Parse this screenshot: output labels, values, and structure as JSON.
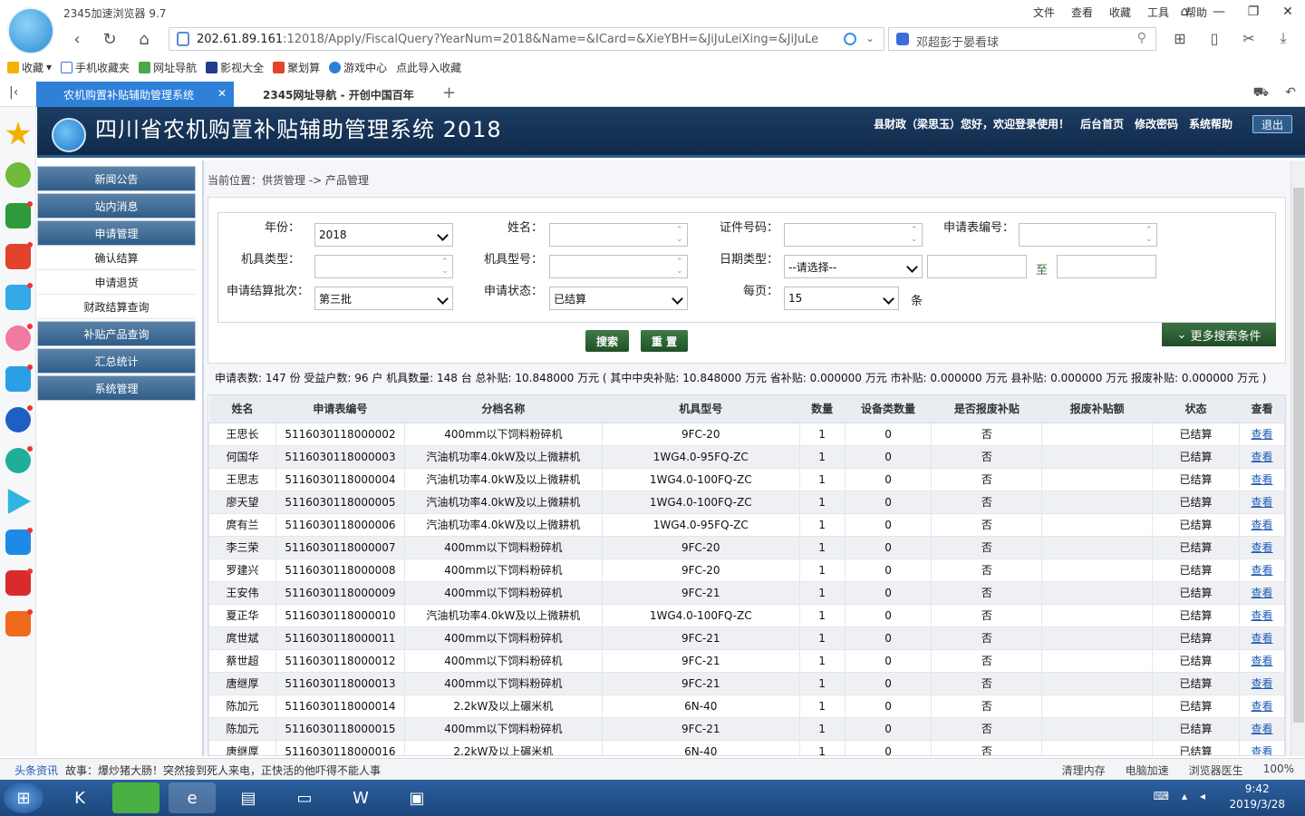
{
  "browser": {
    "app_title": "2345加速浏览器 9.7",
    "menu": [
      "文件",
      "查看",
      "收藏",
      "工具",
      "帮助"
    ],
    "url_host": "202.61.89.161",
    "url_rest": ":12018/Apply/FiscalQuery?YearNum=2018&Name=&ICard=&XieYBH=&JiJuLeiXing=&JiJuLe",
    "search_text": "邓超彭于晏看球",
    "bookmarks": [
      "收藏",
      "手机收藏夹",
      "网址导航",
      "影视大全",
      "聚划算",
      "游戏中心",
      "点此导入收藏"
    ],
    "tabs": [
      {
        "label": "农机购置补贴辅助管理系统",
        "active": true
      },
      {
        "label": "2345网址导航 - 开创中国百年",
        "active": false
      }
    ]
  },
  "header": {
    "system_title": "四川省农机购置补贴辅助管理系统 2018",
    "user_greeting": "县财政（梁思玉）您好，欢迎登录使用！",
    "links": [
      "后台首页",
      "修改密码",
      "系统帮助"
    ],
    "logout": "退出"
  },
  "sidebar": {
    "items": [
      {
        "label": "新闻公告",
        "type": "header"
      },
      {
        "label": "站内消息",
        "type": "header"
      },
      {
        "label": "申请管理",
        "type": "header"
      },
      {
        "label": "确认结算",
        "type": "item"
      },
      {
        "label": "申请退货",
        "type": "item"
      },
      {
        "label": "财政结算查询",
        "type": "item"
      },
      {
        "label": "补贴产品查询",
        "type": "header"
      },
      {
        "label": "汇总统计",
        "type": "header"
      },
      {
        "label": "系统管理",
        "type": "header"
      }
    ]
  },
  "breadcrumb": "当前位置：供货管理 -> 产品管理",
  "search_form": {
    "year_label": "年份：",
    "year_value": "2018",
    "name_label": "姓名：",
    "name_value": "",
    "idcard_label": "证件号码：",
    "idcard_value": "",
    "appno_label": "申请表编号：",
    "appno_value": "",
    "machtype_label": "机具类型：",
    "machtype_value": "",
    "model_label": "机具型号：",
    "model_value": "",
    "datetype_label": "日期类型：",
    "datetype_value": "--请选择--",
    "date_to": "至",
    "batch_label": "申请结算批次：",
    "batch_value": "第三批",
    "status_label": "申请状态：",
    "status_value": "已结算",
    "perpage_label": "每页：",
    "perpage_value": "15",
    "perpage_unit": "条",
    "search_button": "搜索",
    "reset_button": "重 置",
    "more_button": "更多搜索条件"
  },
  "summary": "申请表数: 147 份 受益户数: 96 户 机具数量: 148 台 总补贴: 10.848000 万元 ( 其中中央补贴: 10.848000 万元   省补贴: 0.000000 万元   市补贴: 0.000000 万元   县补贴: 0.000000 万元   报废补贴: 0.000000 万元 )",
  "table": {
    "columns": [
      "姓名",
      "申请表编号",
      "分档名称",
      "机具型号",
      "数量",
      "设备类数量",
      "是否报废补贴",
      "报废补贴额",
      "状态",
      "查看"
    ],
    "rows": [
      [
        "王思长",
        "5116030118000002",
        "400mm以下饲料粉碎机",
        "9FC-20",
        "1",
        "0",
        "否",
        "",
        "已结算",
        "查看"
      ],
      [
        "何国华",
        "5116030118000003",
        "汽油机功率4.0kW及以上微耕机",
        "1WG4.0-95FQ-ZC",
        "1",
        "0",
        "否",
        "",
        "已结算",
        "查看"
      ],
      [
        "王思志",
        "5116030118000004",
        "汽油机功率4.0kW及以上微耕机",
        "1WG4.0-100FQ-ZC",
        "1",
        "0",
        "否",
        "",
        "已结算",
        "查看"
      ],
      [
        "廖天望",
        "5116030118000005",
        "汽油机功率4.0kW及以上微耕机",
        "1WG4.0-100FQ-ZC",
        "1",
        "0",
        "否",
        "",
        "已结算",
        "查看"
      ],
      [
        "庹有兰",
        "5116030118000006",
        "汽油机功率4.0kW及以上微耕机",
        "1WG4.0-95FQ-ZC",
        "1",
        "0",
        "否",
        "",
        "已结算",
        "查看"
      ],
      [
        "李三荣",
        "5116030118000007",
        "400mm以下饲料粉碎机",
        "9FC-20",
        "1",
        "0",
        "否",
        "",
        "已结算",
        "查看"
      ],
      [
        "罗建兴",
        "5116030118000008",
        "400mm以下饲料粉碎机",
        "9FC-20",
        "1",
        "0",
        "否",
        "",
        "已结算",
        "查看"
      ],
      [
        "王安伟",
        "5116030118000009",
        "400mm以下饲料粉碎机",
        "9FC-21",
        "1",
        "0",
        "否",
        "",
        "已结算",
        "查看"
      ],
      [
        "夏正华",
        "5116030118000010",
        "汽油机功率4.0kW及以上微耕机",
        "1WG4.0-100FQ-ZC",
        "1",
        "0",
        "否",
        "",
        "已结算",
        "查看"
      ],
      [
        "庹世斌",
        "5116030118000011",
        "400mm以下饲料粉碎机",
        "9FC-21",
        "1",
        "0",
        "否",
        "",
        "已结算",
        "查看"
      ],
      [
        "蔡世超",
        "5116030118000012",
        "400mm以下饲料粉碎机",
        "9FC-21",
        "1",
        "0",
        "否",
        "",
        "已结算",
        "查看"
      ],
      [
        "唐继厚",
        "5116030118000013",
        "400mm以下饲料粉碎机",
        "9FC-21",
        "1",
        "0",
        "否",
        "",
        "已结算",
        "查看"
      ],
      [
        "陈加元",
        "5116030118000014",
        "2.2kW及以上碾米机",
        "6N-40",
        "1",
        "0",
        "否",
        "",
        "已结算",
        "查看"
      ],
      [
        "陈加元",
        "5116030118000015",
        "400mm以下饲料粉碎机",
        "9FC-21",
        "1",
        "0",
        "否",
        "",
        "已结算",
        "查看"
      ],
      [
        "唐继厚",
        "5116030118000016",
        "2.2kW及以上碾米机",
        "6N-40",
        "1",
        "0",
        "否",
        "",
        "已结算",
        "查看"
      ]
    ]
  },
  "statusbar": {
    "news_label": "头条资讯",
    "news_text": "故事：爆炒猪大肠！突然接到死人来电，正快活的他吓得不能人事",
    "tools": [
      "清理内存",
      "电脑加速",
      "浏览器医生"
    ],
    "zoom": "100%"
  },
  "taskbar": {
    "time": "9:42",
    "date": "2019/3/28"
  }
}
